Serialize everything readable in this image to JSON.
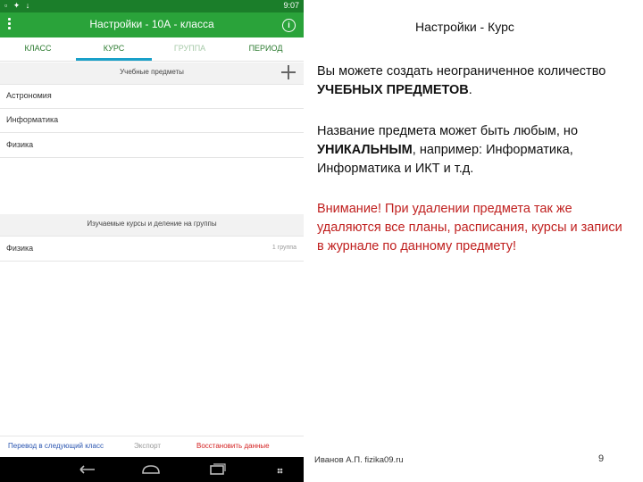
{
  "phone": {
    "status": {
      "left_icons": "▫ ✦ ↓",
      "right_text": "9:07"
    },
    "appbar": {
      "title": "Настройки - 10А - классa"
    },
    "tabs": [
      {
        "label": "КЛАСС"
      },
      {
        "label": "КУРС"
      },
      {
        "label": "ГРУППА"
      },
      {
        "label": "ПЕРИОД"
      }
    ],
    "subjects_header": "Учебные предметы",
    "subjects": [
      "Астрономия",
      "Информатика",
      "Физика"
    ],
    "courses_header": "Изучаемые курсы и деление на группы",
    "courses": [
      {
        "name": "Физика",
        "right": "1 группа"
      }
    ],
    "footer": {
      "transfer": "Перевод в следующий класс",
      "export": "Экспорт",
      "restore": "Восстановить данные"
    }
  },
  "slide": {
    "title": "Настройки - Курс",
    "p1_a": "Вы можете создать неограниченное количество ",
    "p1_b": "УЧЕБНЫХ ПРЕДМЕТОВ",
    "p1_c": ".",
    "p2_a": "Название предмета может быть любым, но ",
    "p2_b": "УНИКАЛЬНЫМ",
    "p2_c": ", например: Информатика, Информатика и ИКТ и т.д.",
    "p3": "Внимание! При удалении предмета так же удаляются все планы, расписания, курсы и записи в журнале по данному предмету!",
    "author": "Иванов А.П. fizika09.ru",
    "page_number": "9"
  },
  "colors": {
    "status_bar": "#1b7e2a",
    "app_bar": "#2aa33a",
    "active_tab_indicator": "#19a0c9",
    "warning_text": "#c0201f",
    "link_blue": "#2a55b0",
    "restore_red": "#d42222"
  }
}
